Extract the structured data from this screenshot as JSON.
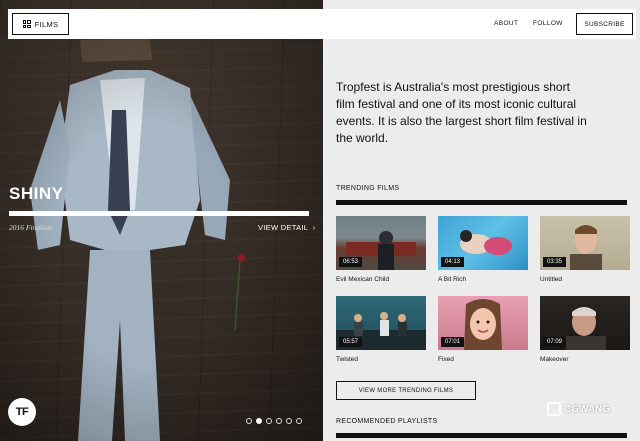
{
  "topbar": {
    "films_label": "FILMS",
    "nav": [
      "ABOUT",
      "FOLLOW"
    ],
    "subscribe_label": "SUBSCRIBE"
  },
  "hero": {
    "title": "SHINY",
    "subtitle": "2016 Finalists",
    "view_detail": "VIEW DETAIL",
    "logo": "TF",
    "dot_count": 6,
    "active_dot": 1
  },
  "intro": "Tropfest is Australia's most prestigious short film festival and one of its most iconic cultural events. It is also the largest short film festival in the world.",
  "trending": {
    "title": "TRENDING FILMS",
    "films": [
      {
        "title": "Evil Mexican Child",
        "duration": "06:53"
      },
      {
        "title": "A Bit Rich",
        "duration": "04:13"
      },
      {
        "title": "Untitled",
        "duration": "03:35"
      },
      {
        "title": "Twisted",
        "duration": "05:57"
      },
      {
        "title": "Fixed",
        "duration": "07:01"
      },
      {
        "title": "Makeover",
        "duration": "07:09"
      }
    ],
    "more_label": "VIEW MORE TRENDING FILMS"
  },
  "playlists": {
    "title": "RECOMMENDED PLAYLISTS"
  },
  "watermark": "CGWANG"
}
